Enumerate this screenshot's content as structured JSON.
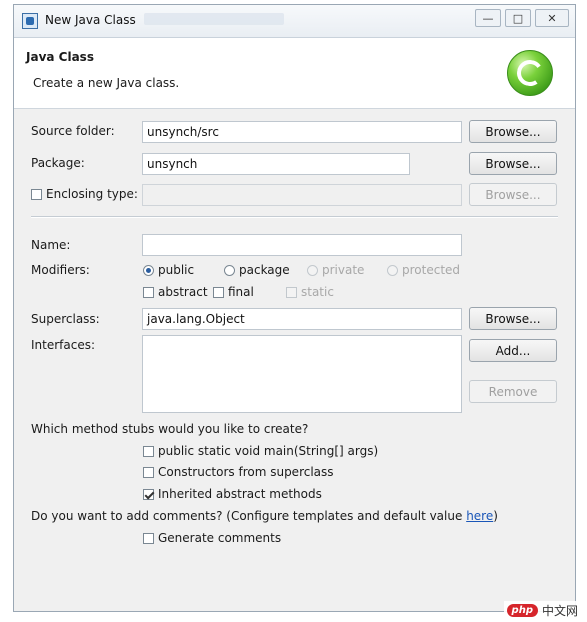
{
  "window": {
    "title": "New Java Class",
    "controls": {
      "minimize": "—",
      "maximize": "□",
      "close": "✕"
    }
  },
  "header": {
    "title": "Java Class",
    "description": "Create a new Java class.",
    "logo_icon": "java-class-c-icon",
    "accent": "#5bb52a"
  },
  "form": {
    "source_folder": {
      "label": "Source folder:",
      "value": "unsynch/src",
      "button": "Browse..."
    },
    "package": {
      "label": "Package:",
      "value": "unsynch",
      "button": "Browse..."
    },
    "enclosing_type": {
      "label": "Enclosing type:",
      "checked": false,
      "value": "",
      "button": "Browse..."
    },
    "name": {
      "label": "Name:",
      "value": ""
    },
    "modifiers": {
      "label": "Modifiers:",
      "access": [
        {
          "label": "public",
          "selected": true,
          "enabled": true
        },
        {
          "label": "package",
          "selected": false,
          "enabled": true
        },
        {
          "label": "private",
          "selected": false,
          "enabled": false
        },
        {
          "label": "protected",
          "selected": false,
          "enabled": false
        }
      ],
      "flags": [
        {
          "label": "abstract",
          "checked": false,
          "enabled": true
        },
        {
          "label": "final",
          "checked": false,
          "enabled": true
        },
        {
          "label": "static",
          "checked": false,
          "enabled": false
        }
      ]
    },
    "superclass": {
      "label": "Superclass:",
      "value": "java.lang.Object",
      "button": "Browse..."
    },
    "interfaces": {
      "label": "Interfaces:",
      "add_button": "Add...",
      "remove_button": "Remove"
    },
    "stubs": {
      "question": "Which method stubs would you like to create?",
      "options": [
        {
          "label": "public static void main(String[] args)",
          "checked": false
        },
        {
          "label": "Constructors from superclass",
          "checked": false
        },
        {
          "label": "Inherited abstract methods",
          "checked": true
        }
      ]
    },
    "comments": {
      "question": "Do you want to add comments? (Configure templates and default value ",
      "link": "here",
      "question_end": ")",
      "option": {
        "label": "Generate comments",
        "checked": false
      }
    }
  },
  "watermark": {
    "logo": "php",
    "text": "中文网"
  }
}
